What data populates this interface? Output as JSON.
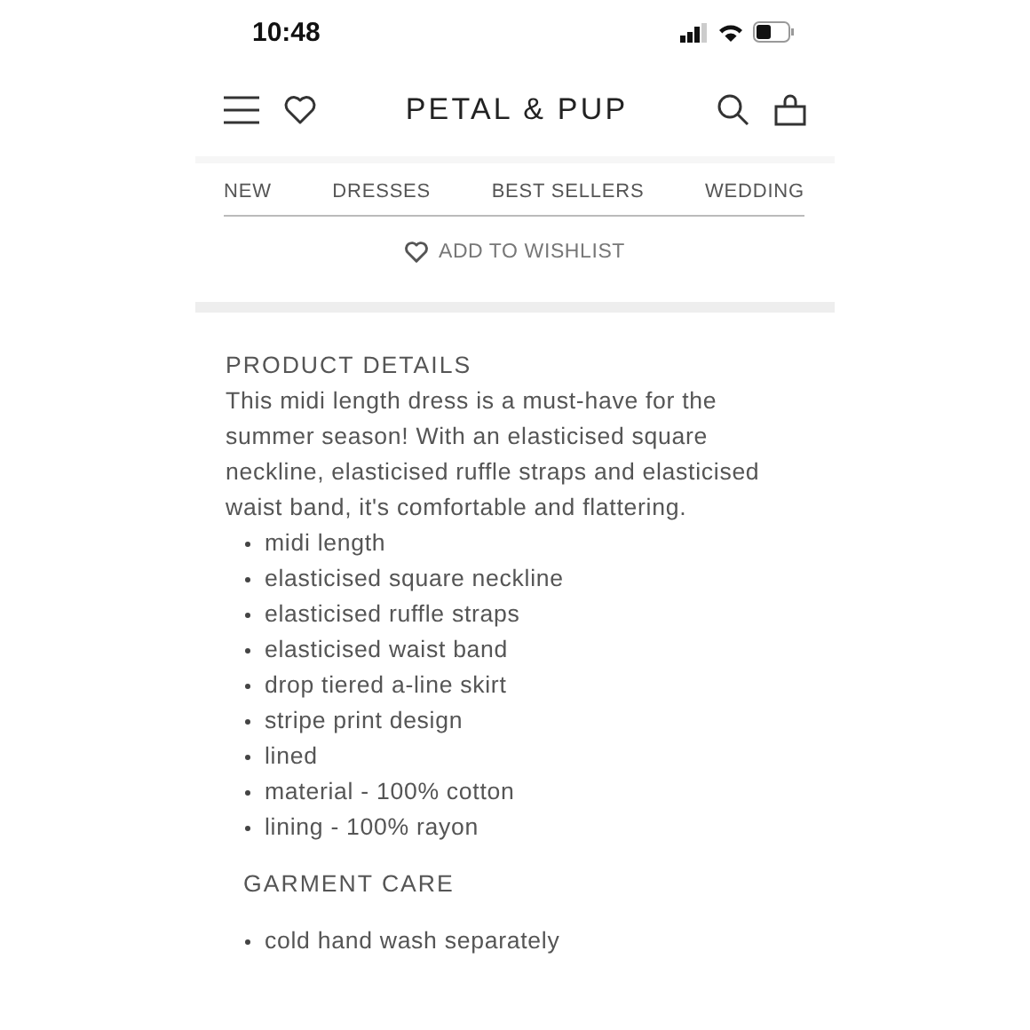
{
  "status_bar": {
    "time": "10:48"
  },
  "header": {
    "logo": "PETAL & PUP"
  },
  "nav": [
    {
      "label": "NEW"
    },
    {
      "label": "DRESSES"
    },
    {
      "label": "BEST SELLERS"
    },
    {
      "label": "WEDDING"
    }
  ],
  "wishlist_button": {
    "label": "ADD TO WISHLIST"
  },
  "product_details": {
    "heading": "PRODUCT DETAILS",
    "description": "This midi length dress is a must-have for the summer season! With an elasticised square neckline, elasticised ruffle straps and elasticised waist band, it's comfortable and flattering.",
    "bullets": [
      "midi length",
      "elasticised square neckline",
      "elasticised ruffle straps",
      "elasticised waist band",
      "drop tiered a-line skirt",
      "stripe print design",
      "lined",
      "material - 100% cotton",
      "lining - 100% rayon"
    ]
  },
  "garment_care": {
    "heading": "GARMENT CARE",
    "bullets": [
      "cold hand wash separately"
    ]
  }
}
